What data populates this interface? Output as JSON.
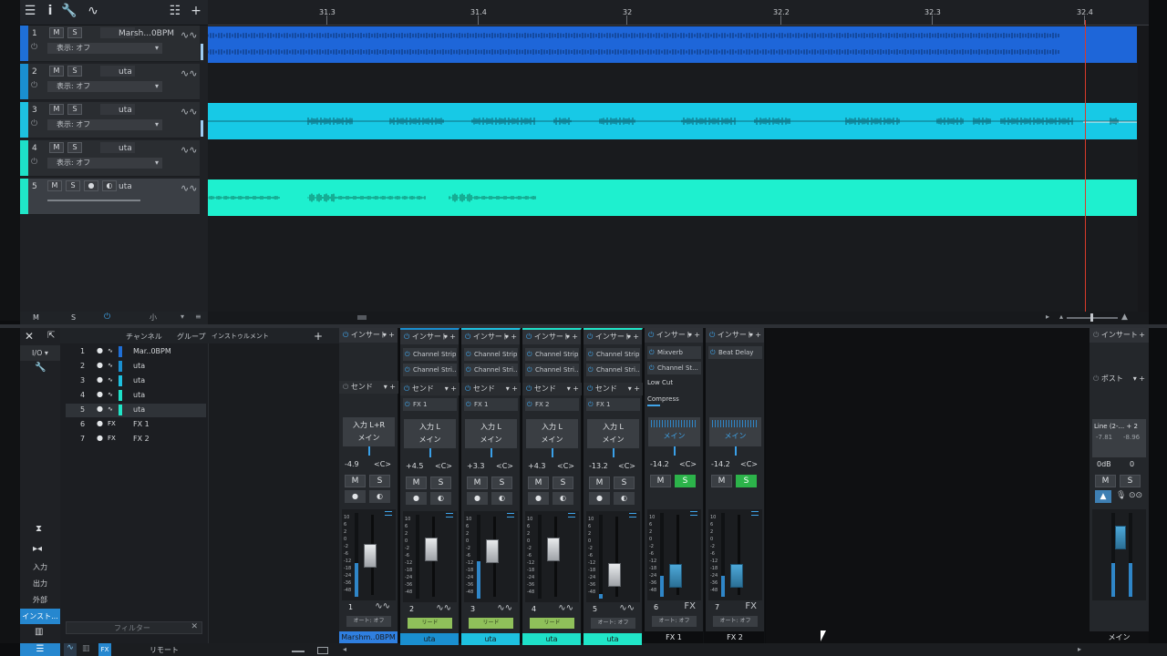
{
  "ruler": {
    "marks": [
      "31.3",
      "31.4",
      "32",
      "32.2",
      "32.3",
      "32.4"
    ]
  },
  "toolbar": {
    "info": "i"
  },
  "tracks": [
    {
      "num": "1",
      "mute": "M",
      "solo": "S",
      "name": "Marsh...0BPM",
      "display": "表示: オフ",
      "color": "#1f6fd6",
      "lane_color": "#1e66d9",
      "selected": false
    },
    {
      "num": "2",
      "mute": "M",
      "solo": "S",
      "name": "uta",
      "display": "表示: オフ",
      "color": "#1a8fd0",
      "lane_color": "",
      "selected": false
    },
    {
      "num": "3",
      "mute": "M",
      "solo": "S",
      "name": "uta",
      "display": "表示: オフ",
      "color": "#1ec1e0",
      "lane_color": "#17c9e6",
      "selected": false
    },
    {
      "num": "4",
      "mute": "M",
      "solo": "S",
      "name": "uta",
      "display": "表示: オフ",
      "color": "#1ee0c8",
      "lane_color": "",
      "selected": false
    },
    {
      "num": "5",
      "mute": "M",
      "solo": "S",
      "name": "uta",
      "display": "",
      "color": "#20e6c8",
      "lane_color": "#1ef0cf",
      "selected": true
    }
  ],
  "track_footer": {
    "m": "M",
    "s": "S"
  },
  "mixer": {
    "tabs": {
      "channel": "チャンネル",
      "group": "グループ",
      "instrument": "インストゥルメント"
    },
    "left_buttons": [
      "I/O",
      "入力",
      "出力",
      "外部",
      "インスト..."
    ],
    "filter_placeholder": "フィルター",
    "remote": "リモート",
    "channels": [
      {
        "num": "1",
        "type": "wave",
        "name": "Mar..0BPM",
        "color": "#1f6fd6",
        "selected": false
      },
      {
        "num": "2",
        "type": "wave",
        "name": "uta",
        "color": "#1a8fd0",
        "selected": false
      },
      {
        "num": "3",
        "type": "wave",
        "name": "uta",
        "color": "#1ec1e0",
        "selected": false
      },
      {
        "num": "4",
        "type": "wave",
        "name": "uta",
        "color": "#1ee0c8",
        "selected": false
      },
      {
        "num": "5",
        "type": "wave",
        "name": "uta",
        "color": "#20e6c8",
        "selected": true
      },
      {
        "num": "6",
        "type": "FX",
        "name": "FX 1",
        "color": "",
        "selected": false
      },
      {
        "num": "7",
        "type": "FX",
        "name": "FX 2",
        "color": "",
        "selected": false
      }
    ],
    "strips": [
      {
        "insert": "インサート",
        "slots": [],
        "send": "センド",
        "send_slot": "",
        "input": "入力 L+R",
        "output": "メイン",
        "vol": "-4.9",
        "pan": "<C>",
        "m": "M",
        "s": "S",
        "solo_on": false,
        "num": "1",
        "icon": "wave",
        "auto": "オート: オフ",
        "auto_green": false,
        "name": "Marshm..0BPM",
        "name_color": "#2f7fe0",
        "fader": 0.72,
        "blue": false,
        "meter": 0.4
      },
      {
        "insert": "インサート",
        "slots": [
          "Channel Strip",
          "Channel Stri..."
        ],
        "send": "センド",
        "send_slot": "FX 1",
        "input": "入力 L",
        "output": "メイン",
        "vol": "+4.5",
        "pan": "<C>",
        "m": "M",
        "s": "S",
        "solo_on": false,
        "num": "2",
        "icon": "wave",
        "auto": "リード",
        "auto_green": true,
        "name": "uta",
        "name_color": "#1a8fd0",
        "fader": 0.82,
        "blue": false,
        "meter": 0.0
      },
      {
        "insert": "インサート",
        "slots": [
          "Channel Strip",
          "Channel Stri..."
        ],
        "send": "センド",
        "send_slot": "FX 1",
        "input": "入力 L",
        "output": "メイン",
        "vol": "+3.3",
        "pan": "<C>",
        "m": "M",
        "s": "S",
        "solo_on": false,
        "num": "3",
        "icon": "wave",
        "auto": "リード",
        "auto_green": true,
        "name": "uta",
        "name_color": "#1ec1e0",
        "fader": 0.8,
        "blue": false,
        "meter": 0.45
      },
      {
        "insert": "インサート",
        "slots": [
          "Channel Strip",
          "Channel Stri..."
        ],
        "send": "センド",
        "send_slot": "FX 2",
        "input": "入力 L",
        "output": "メイン",
        "vol": "+4.3",
        "pan": "<C>",
        "m": "M",
        "s": "S",
        "solo_on": false,
        "num": "4",
        "icon": "wave",
        "auto": "リード",
        "auto_green": true,
        "name": "uta",
        "name_color": "#1ee0c8",
        "fader": 0.82,
        "blue": false,
        "meter": 0.0
      },
      {
        "insert": "インサート",
        "slots": [
          "Channel Strip",
          "Channel Stri..."
        ],
        "send": "センド",
        "send_slot": "FX 1",
        "input": "入力 L",
        "output": "メイン",
        "vol": "-13.2",
        "pan": "<C>",
        "m": "M",
        "s": "S",
        "solo_on": false,
        "num": "5",
        "icon": "wave",
        "auto": "オート: オフ",
        "auto_green": false,
        "name": "uta",
        "name_color": "#20e6c8",
        "fader": 0.5,
        "blue": false,
        "meter": 0.05
      },
      {
        "insert": "インサート",
        "slots": [
          "Mixverb",
          "Channel St..."
        ],
        "send": "",
        "send_slot": "",
        "low_cut": "Low Cut",
        "compress": "Compress",
        "input": "",
        "output": "メイン",
        "vol": "-14.2",
        "pan": "<C>",
        "m": "M",
        "s": "S",
        "solo_on": true,
        "num": "6",
        "icon": "FX",
        "auto": "オート: オフ",
        "auto_green": false,
        "name": "FX 1",
        "name_color": "#0c0d0f",
        "fader": 0.47,
        "blue": true,
        "meter": 0.25
      },
      {
        "insert": "インサート",
        "slots": [
          "Beat Delay"
        ],
        "send": "",
        "send_slot": "",
        "input": "",
        "output": "メイン",
        "vol": "-14.2",
        "pan": "<C>",
        "m": "M",
        "s": "S",
        "solo_on": true,
        "num": "7",
        "icon": "FX",
        "auto": "オート: オフ",
        "auto_green": false,
        "name": "FX 2",
        "name_color": "#0c0d0f",
        "fader": 0.47,
        "blue": true,
        "meter": 0.25
      }
    ],
    "main": {
      "insert": "インサート",
      "post": "ポスト",
      "output": "Line (2-... + 2",
      "peak_l": "-7.81",
      "peak_r": "-8.96",
      "db": "0dB",
      "pan": "0",
      "m": "M",
      "s": "S",
      "name": "メイン"
    }
  },
  "scale_marks": [
    "10",
    "6",
    "2",
    "0",
    "-2",
    "-6",
    "-12",
    "-18",
    "-24",
    "-36",
    "-48"
  ]
}
